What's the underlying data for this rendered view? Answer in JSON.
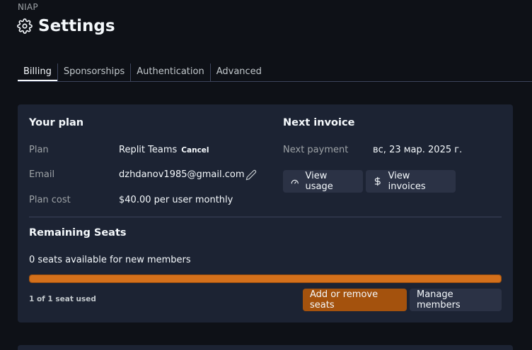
{
  "org": "NIAP",
  "page_title": "Settings",
  "tabs": [
    {
      "label": "Billing"
    },
    {
      "label": "Sponsorships"
    },
    {
      "label": "Authentication"
    },
    {
      "label": "Advanced"
    }
  ],
  "plan_section": {
    "heading": "Your plan",
    "plan_label": "Plan",
    "plan_value": "Replit Teams",
    "cancel_label": "Cancel",
    "email_label": "Email",
    "email_value": "dzhdanov1985@gmail.com",
    "cost_label": "Plan cost",
    "cost_value": "$40.00 per user monthly"
  },
  "invoice_section": {
    "heading": "Next invoice",
    "payment_label": "Next payment",
    "payment_value": "вс, 23 мар. 2025 г.",
    "view_usage_label": "View usage",
    "view_invoices_label": "View invoices"
  },
  "seats_section": {
    "heading": "Remaining Seats",
    "available_text": "0 seats available for new members",
    "used_text": "1 of 1 seat used",
    "usage_fraction": 1.0,
    "add_remove_label": "Add or remove seats",
    "manage_label": "Manage members"
  },
  "colors": {
    "background": "#0e1117",
    "card": "#1c2333",
    "accent_orange": "#d4701b",
    "button_orange": "#a4520d",
    "button": "#2b3245"
  }
}
